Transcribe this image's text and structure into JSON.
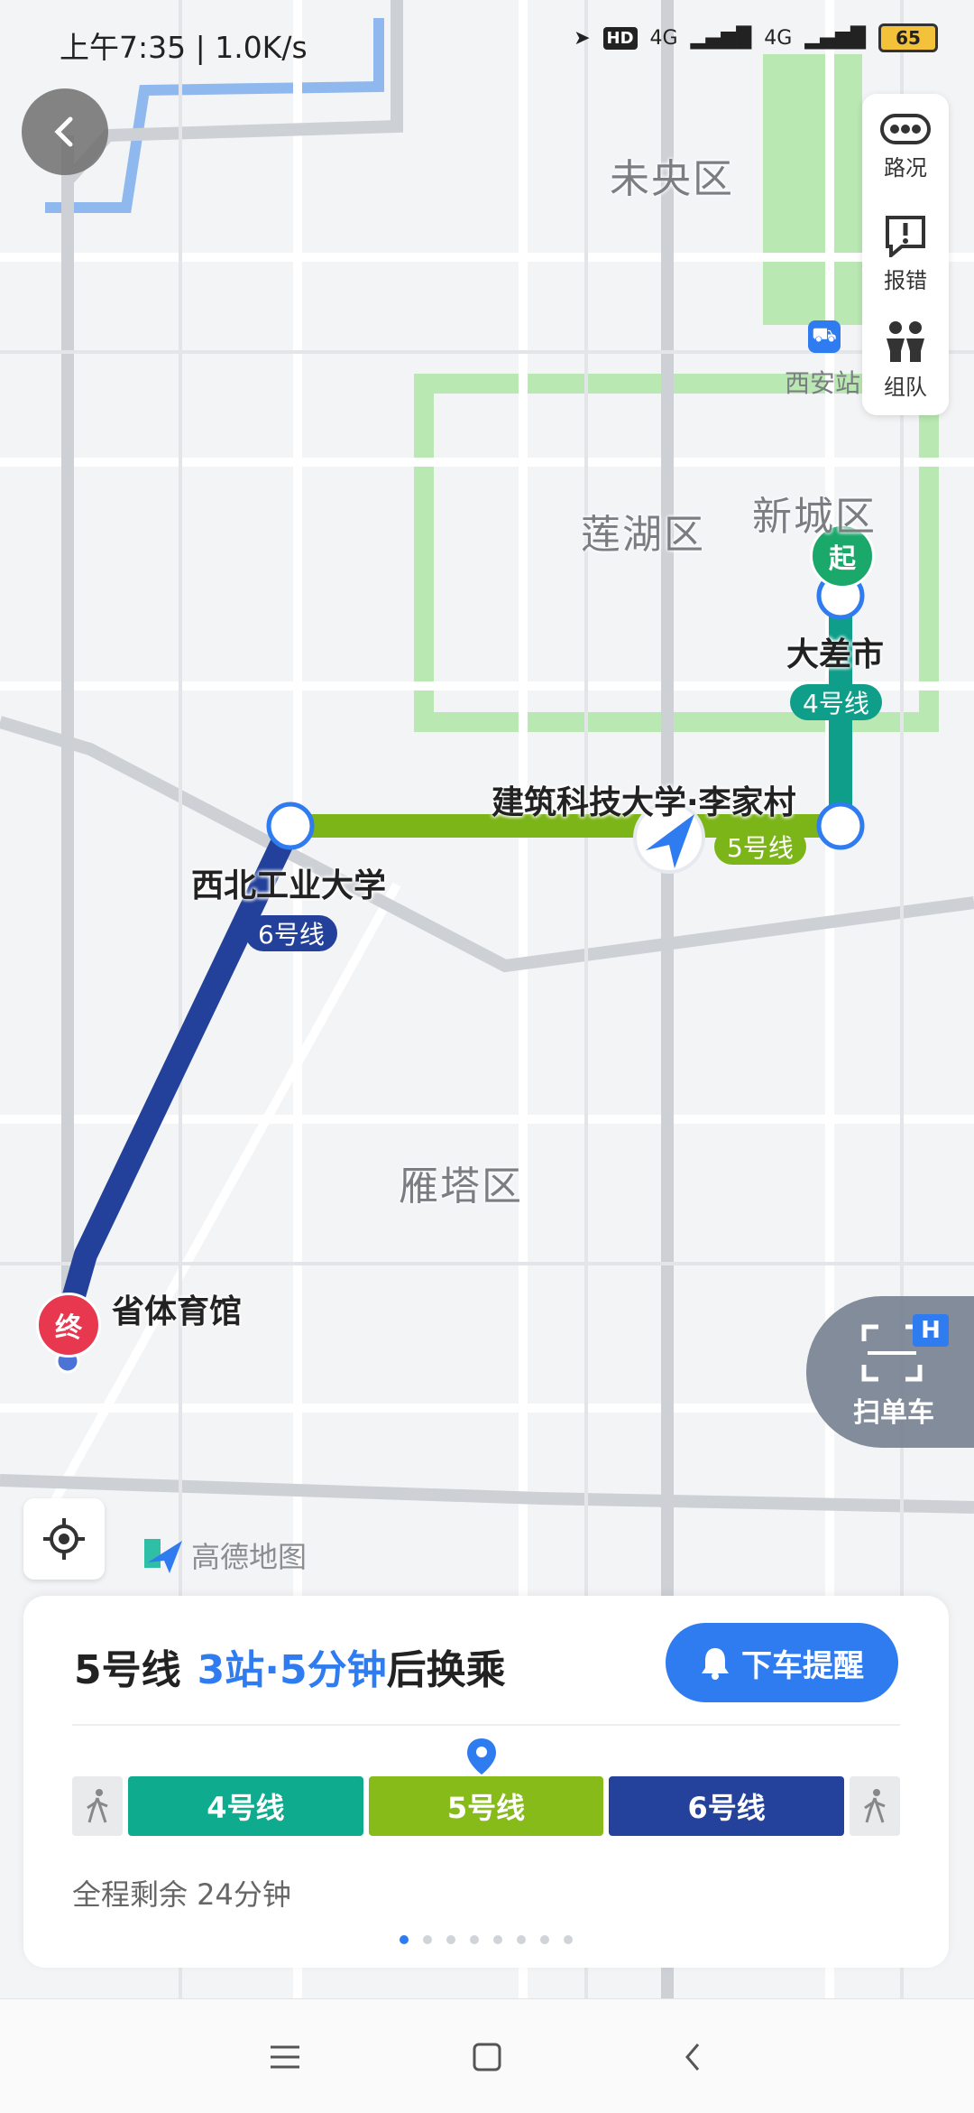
{
  "status_bar": {
    "time": "上午7:35 | 1.0K/s",
    "hd": "HD",
    "net1": "4G",
    "net2": "4G",
    "battery": "65"
  },
  "side_panel": {
    "items": [
      {
        "label": "路况",
        "icon": "traffic-icon"
      },
      {
        "label": "报错",
        "icon": "report-icon"
      },
      {
        "label": "组队",
        "icon": "team-icon"
      }
    ]
  },
  "map": {
    "districts": [
      "未央区",
      "莲湖区",
      "新城区",
      "雁塔区"
    ],
    "poi_xian_station": "西安站",
    "start_marker": "起",
    "end_marker": "终",
    "stations": {
      "start": "大差市",
      "transfer1": "建筑科技大学·李家村",
      "transfer2": "西北工业大学",
      "end": "省体育馆"
    },
    "lines": [
      {
        "name": "4号线",
        "color": "#0e9e8a"
      },
      {
        "name": "5号线",
        "color": "#7cb518"
      },
      {
        "name": "6号线",
        "color": "#23419a"
      }
    ],
    "brand": "高德地图",
    "scan_label": "扫单车"
  },
  "card": {
    "line": "5号线",
    "highlight": "3站·5分钟",
    "suffix": "后换乘",
    "remind_button": "下车提醒",
    "segments": [
      {
        "label": "4号线",
        "color": "#0eab8f"
      },
      {
        "label": "5号线",
        "color": "#86bb1a"
      },
      {
        "label": "6号线",
        "color": "#24419c"
      }
    ],
    "remaining": "全程剩余 24分钟",
    "pages": 8,
    "active_page": 1
  }
}
